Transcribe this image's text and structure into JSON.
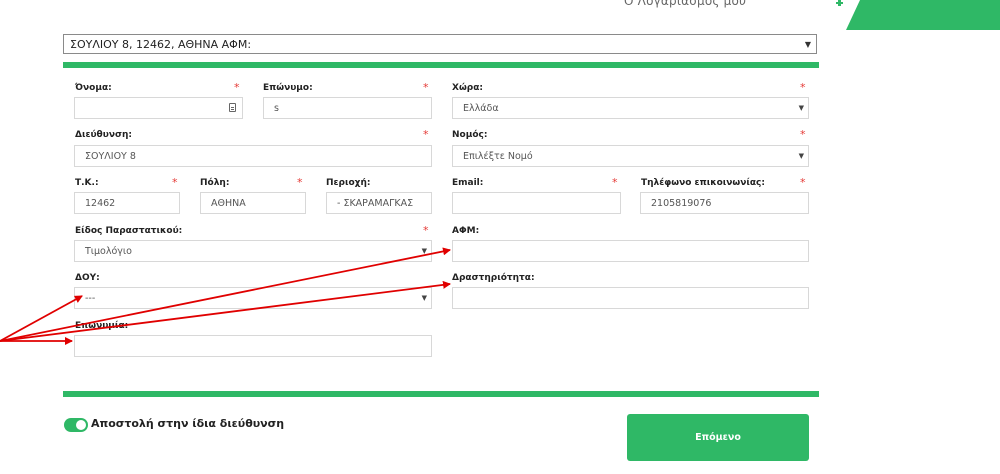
{
  "header": {
    "account_link": "Ο Λογαριασμός μου"
  },
  "address_select": {
    "value": "ΣΟΥΛΙΟΥ 8, 12462, ΑΘΗΝΑ ΑΦΜ:"
  },
  "form": {
    "first_name": {
      "label": "Όνομα:",
      "value": "",
      "required": "*"
    },
    "last_name": {
      "label": "Επώνυμο:",
      "value": "s",
      "required": "*"
    },
    "country": {
      "label": "Χώρα:",
      "value": "Ελλάδα",
      "required": "*"
    },
    "address": {
      "label": "Διεύθυνση:",
      "value": "ΣΟΥΛΙΟΥ 8",
      "required": "*"
    },
    "prefecture": {
      "label": "Νομός:",
      "value": "Επιλέξτε Νομό",
      "required": "*"
    },
    "postal_code": {
      "label": "Τ.Κ.:",
      "value": "12462",
      "required": "*"
    },
    "city": {
      "label": "Πόλη:",
      "value": "ΑΘΗΝΑ",
      "required": "*"
    },
    "area": {
      "label": "Περιοχή:",
      "value": "- ΣΚΑΡΑΜΑΓΚΑΣ"
    },
    "email": {
      "label": "Email:",
      "value": "",
      "required": "*"
    },
    "phone": {
      "label": "Τηλέφωνο επικοινωνίας:",
      "value": "2105819076",
      "required": "*"
    },
    "document_type": {
      "label": "Είδος Παραστατικού:",
      "value": "Τιμολόγιο",
      "required": "*"
    },
    "vat_number": {
      "label": "ΑΦΜ:",
      "value": ""
    },
    "tax_office": {
      "label": "ΔΟΥ:",
      "value": "---"
    },
    "activity": {
      "label": "Δραστηριότητα:",
      "value": ""
    },
    "company_name": {
      "label": "Επωνυμία:",
      "value": ""
    }
  },
  "shipping_toggle": {
    "label": "Αποστολή στην ίδια διεύθυνση",
    "state": "on"
  },
  "next_button": {
    "label": "Επόμενο"
  },
  "colors": {
    "accent": "#2fb866",
    "required": "#e53935",
    "annotation_arrow": "#e00000"
  },
  "icons": {
    "contact_card": "contact-card-icon",
    "dropdown": "chevron-down-icon"
  }
}
